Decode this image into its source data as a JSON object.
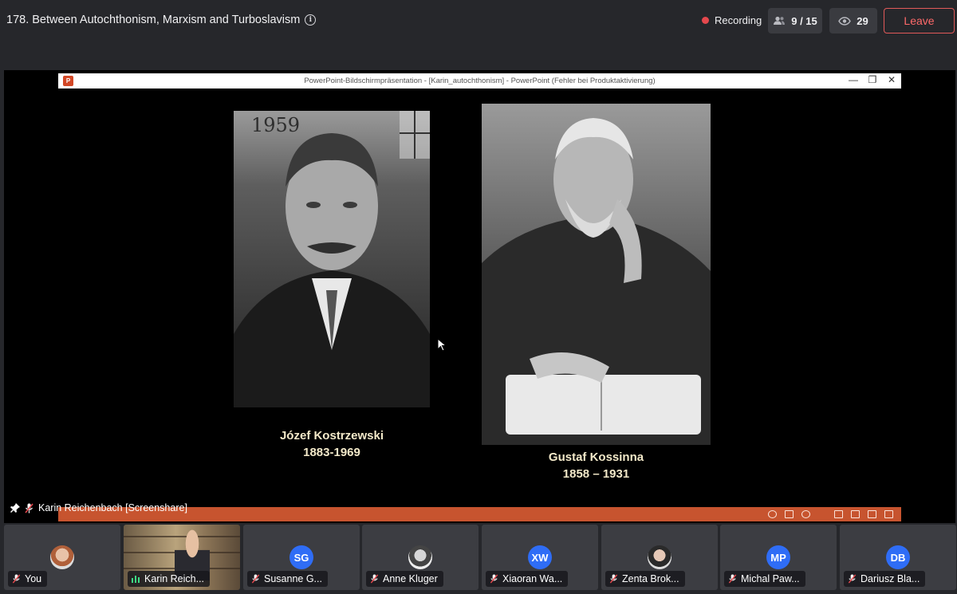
{
  "header": {
    "meeting_title": "178. Between Autochthonism, Marxism and Turboslavism",
    "recording_label": "Recording",
    "participants_count": "9 / 15",
    "viewers_count": "29",
    "leave_label": "Leave"
  },
  "stage": {
    "ppt_window_title": "PowerPoint-Bildschirmpräsentation - [Karin_autochthonism] - PowerPoint (Fehler bei Produktaktivierung)",
    "slide": {
      "left_person_name": "Józef Kostrzewski",
      "left_person_years": "1883-1969",
      "left_photo_inscription": "1959",
      "right_person_name": "Gustaf Kossinna",
      "right_person_years": "1858 – 1931"
    },
    "presenter_label": "Karin Reichenbach [Screenshare]"
  },
  "participants": [
    {
      "name": "You",
      "avatar": "photo"
    },
    {
      "name": "Karin Reich...",
      "avatar": "video"
    },
    {
      "name": "Susanne G...",
      "initials": "SG"
    },
    {
      "name": "Anne Kluger",
      "avatar": "photo"
    },
    {
      "name": "Xiaoran Wa...",
      "initials": "XW"
    },
    {
      "name": "Zenta Brok...",
      "avatar": "photo"
    },
    {
      "name": "Michal Paw...",
      "initials": "MP"
    },
    {
      "name": "Dariusz Bla...",
      "initials": "DB"
    }
  ],
  "colors": {
    "accent_red": "#e5484d",
    "avatar_blue": "#2f6df6",
    "ppt_orange": "#c7542f",
    "caption_cream": "#f3e9c9"
  }
}
